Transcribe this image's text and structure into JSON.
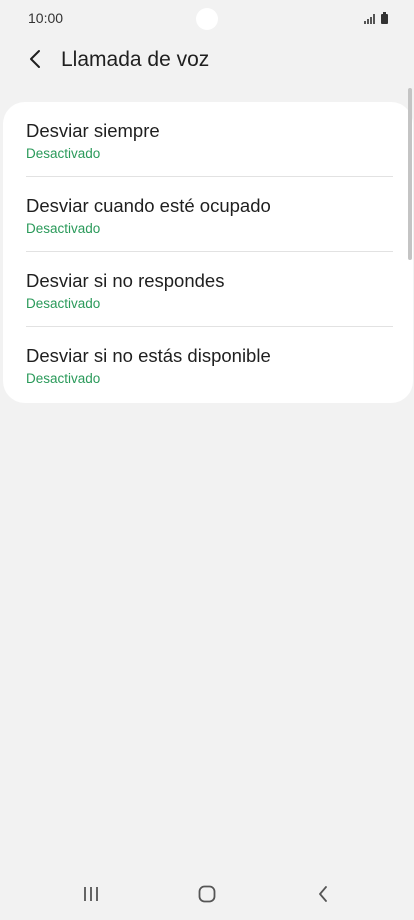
{
  "status_bar": {
    "time": "10:00"
  },
  "header": {
    "back_icon": "chevron-left-icon",
    "title": "Llamada de voz"
  },
  "items": [
    {
      "title": "Desviar siempre",
      "status": "Desactivado"
    },
    {
      "title": "Desviar cuando esté ocupado",
      "status": "Desactivado"
    },
    {
      "title": "Desviar si no respondes",
      "status": "Desactivado"
    },
    {
      "title": "Desviar si no estás disponible",
      "status": "Desactivado"
    }
  ],
  "nav_bar": {
    "recents_icon": "recents-icon",
    "home_icon": "home-icon",
    "back_icon": "back-icon"
  },
  "colors": {
    "background": "#f2f2f2",
    "card": "#ffffff",
    "status_text": "#2a9a5a"
  }
}
